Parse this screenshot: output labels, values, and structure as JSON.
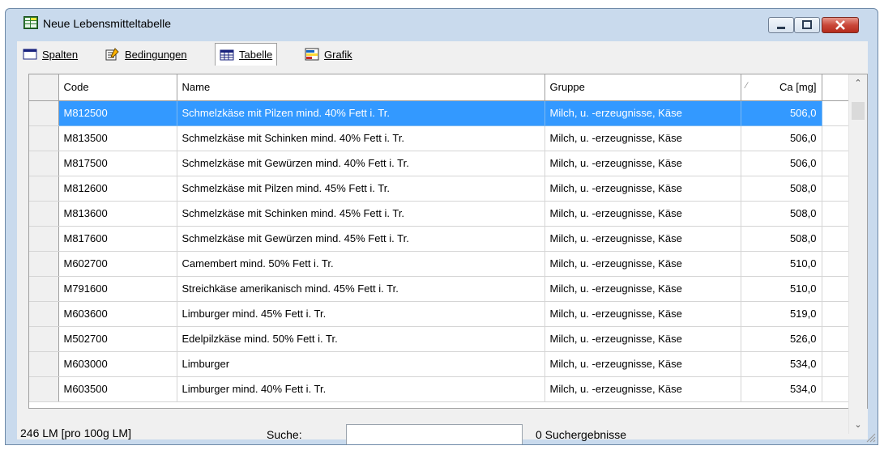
{
  "window": {
    "title": "Neue Lebensmitteltabelle"
  },
  "tabs": [
    {
      "label": "Spalten",
      "icon": "window-icon"
    },
    {
      "label": "Bedingungen",
      "icon": "conditions-icon"
    },
    {
      "label": "Tabelle",
      "icon": "table-icon",
      "active": true
    },
    {
      "label": "Grafik",
      "icon": "chart-icon"
    }
  ],
  "table": {
    "columns": [
      "Code",
      "Name",
      "Gruppe",
      "Ca [mg]"
    ],
    "sort_column": "Ca [mg]",
    "rows": [
      {
        "code": "M812500",
        "name": "Schmelzkäse mit Pilzen mind. 40% Fett i. Tr.",
        "group": "Milch, u. -erzeugnisse, Käse",
        "ca": "506,0",
        "selected": true
      },
      {
        "code": "M813500",
        "name": "Schmelzkäse mit Schinken mind. 40% Fett i. Tr.",
        "group": "Milch, u. -erzeugnisse, Käse",
        "ca": "506,0"
      },
      {
        "code": "M817500",
        "name": "Schmelzkäse mit Gewürzen mind. 40% Fett i. Tr.",
        "group": "Milch, u. -erzeugnisse, Käse",
        "ca": "506,0"
      },
      {
        "code": "M812600",
        "name": "Schmelzkäse mit Pilzen mind. 45% Fett i. Tr.",
        "group": "Milch, u. -erzeugnisse, Käse",
        "ca": "508,0"
      },
      {
        "code": "M813600",
        "name": "Schmelzkäse mit Schinken mind. 45% Fett i. Tr.",
        "group": "Milch, u. -erzeugnisse, Käse",
        "ca": "508,0"
      },
      {
        "code": "M817600",
        "name": "Schmelzkäse mit Gewürzen mind. 45% Fett i. Tr.",
        "group": "Milch, u. -erzeugnisse, Käse",
        "ca": "508,0"
      },
      {
        "code": "M602700",
        "name": "Camembert mind. 50% Fett i. Tr.",
        "group": "Milch, u. -erzeugnisse, Käse",
        "ca": "510,0"
      },
      {
        "code": "M791600",
        "name": "Streichkäse amerikanisch mind. 45% Fett i. Tr.",
        "group": "Milch, u. -erzeugnisse, Käse",
        "ca": "510,0"
      },
      {
        "code": "M603600",
        "name": "Limburger mind. 45% Fett i. Tr.",
        "group": "Milch, u. -erzeugnisse, Käse",
        "ca": "519,0"
      },
      {
        "code": "M502700",
        "name": "Edelpilzkäse mind. 50% Fett i. Tr.",
        "group": "Milch, u. -erzeugnisse, Käse",
        "ca": "526,0"
      },
      {
        "code": "M603000",
        "name": "Limburger",
        "group": "Milch, u. -erzeugnisse, Käse",
        "ca": "534,0"
      },
      {
        "code": "M603500",
        "name": "Limburger mind. 40% Fett i. Tr.",
        "group": "Milch, u. -erzeugnisse, Käse",
        "ca": "534,0"
      }
    ]
  },
  "status": {
    "count_text": "246 LM [pro 100g LM]",
    "search_label": "Suche:",
    "search_value": "",
    "results_text": "0 Suchergebnisse"
  },
  "colors": {
    "selection": "#3399ff",
    "frame": "#c9daed",
    "close_button": "#c9483a"
  }
}
